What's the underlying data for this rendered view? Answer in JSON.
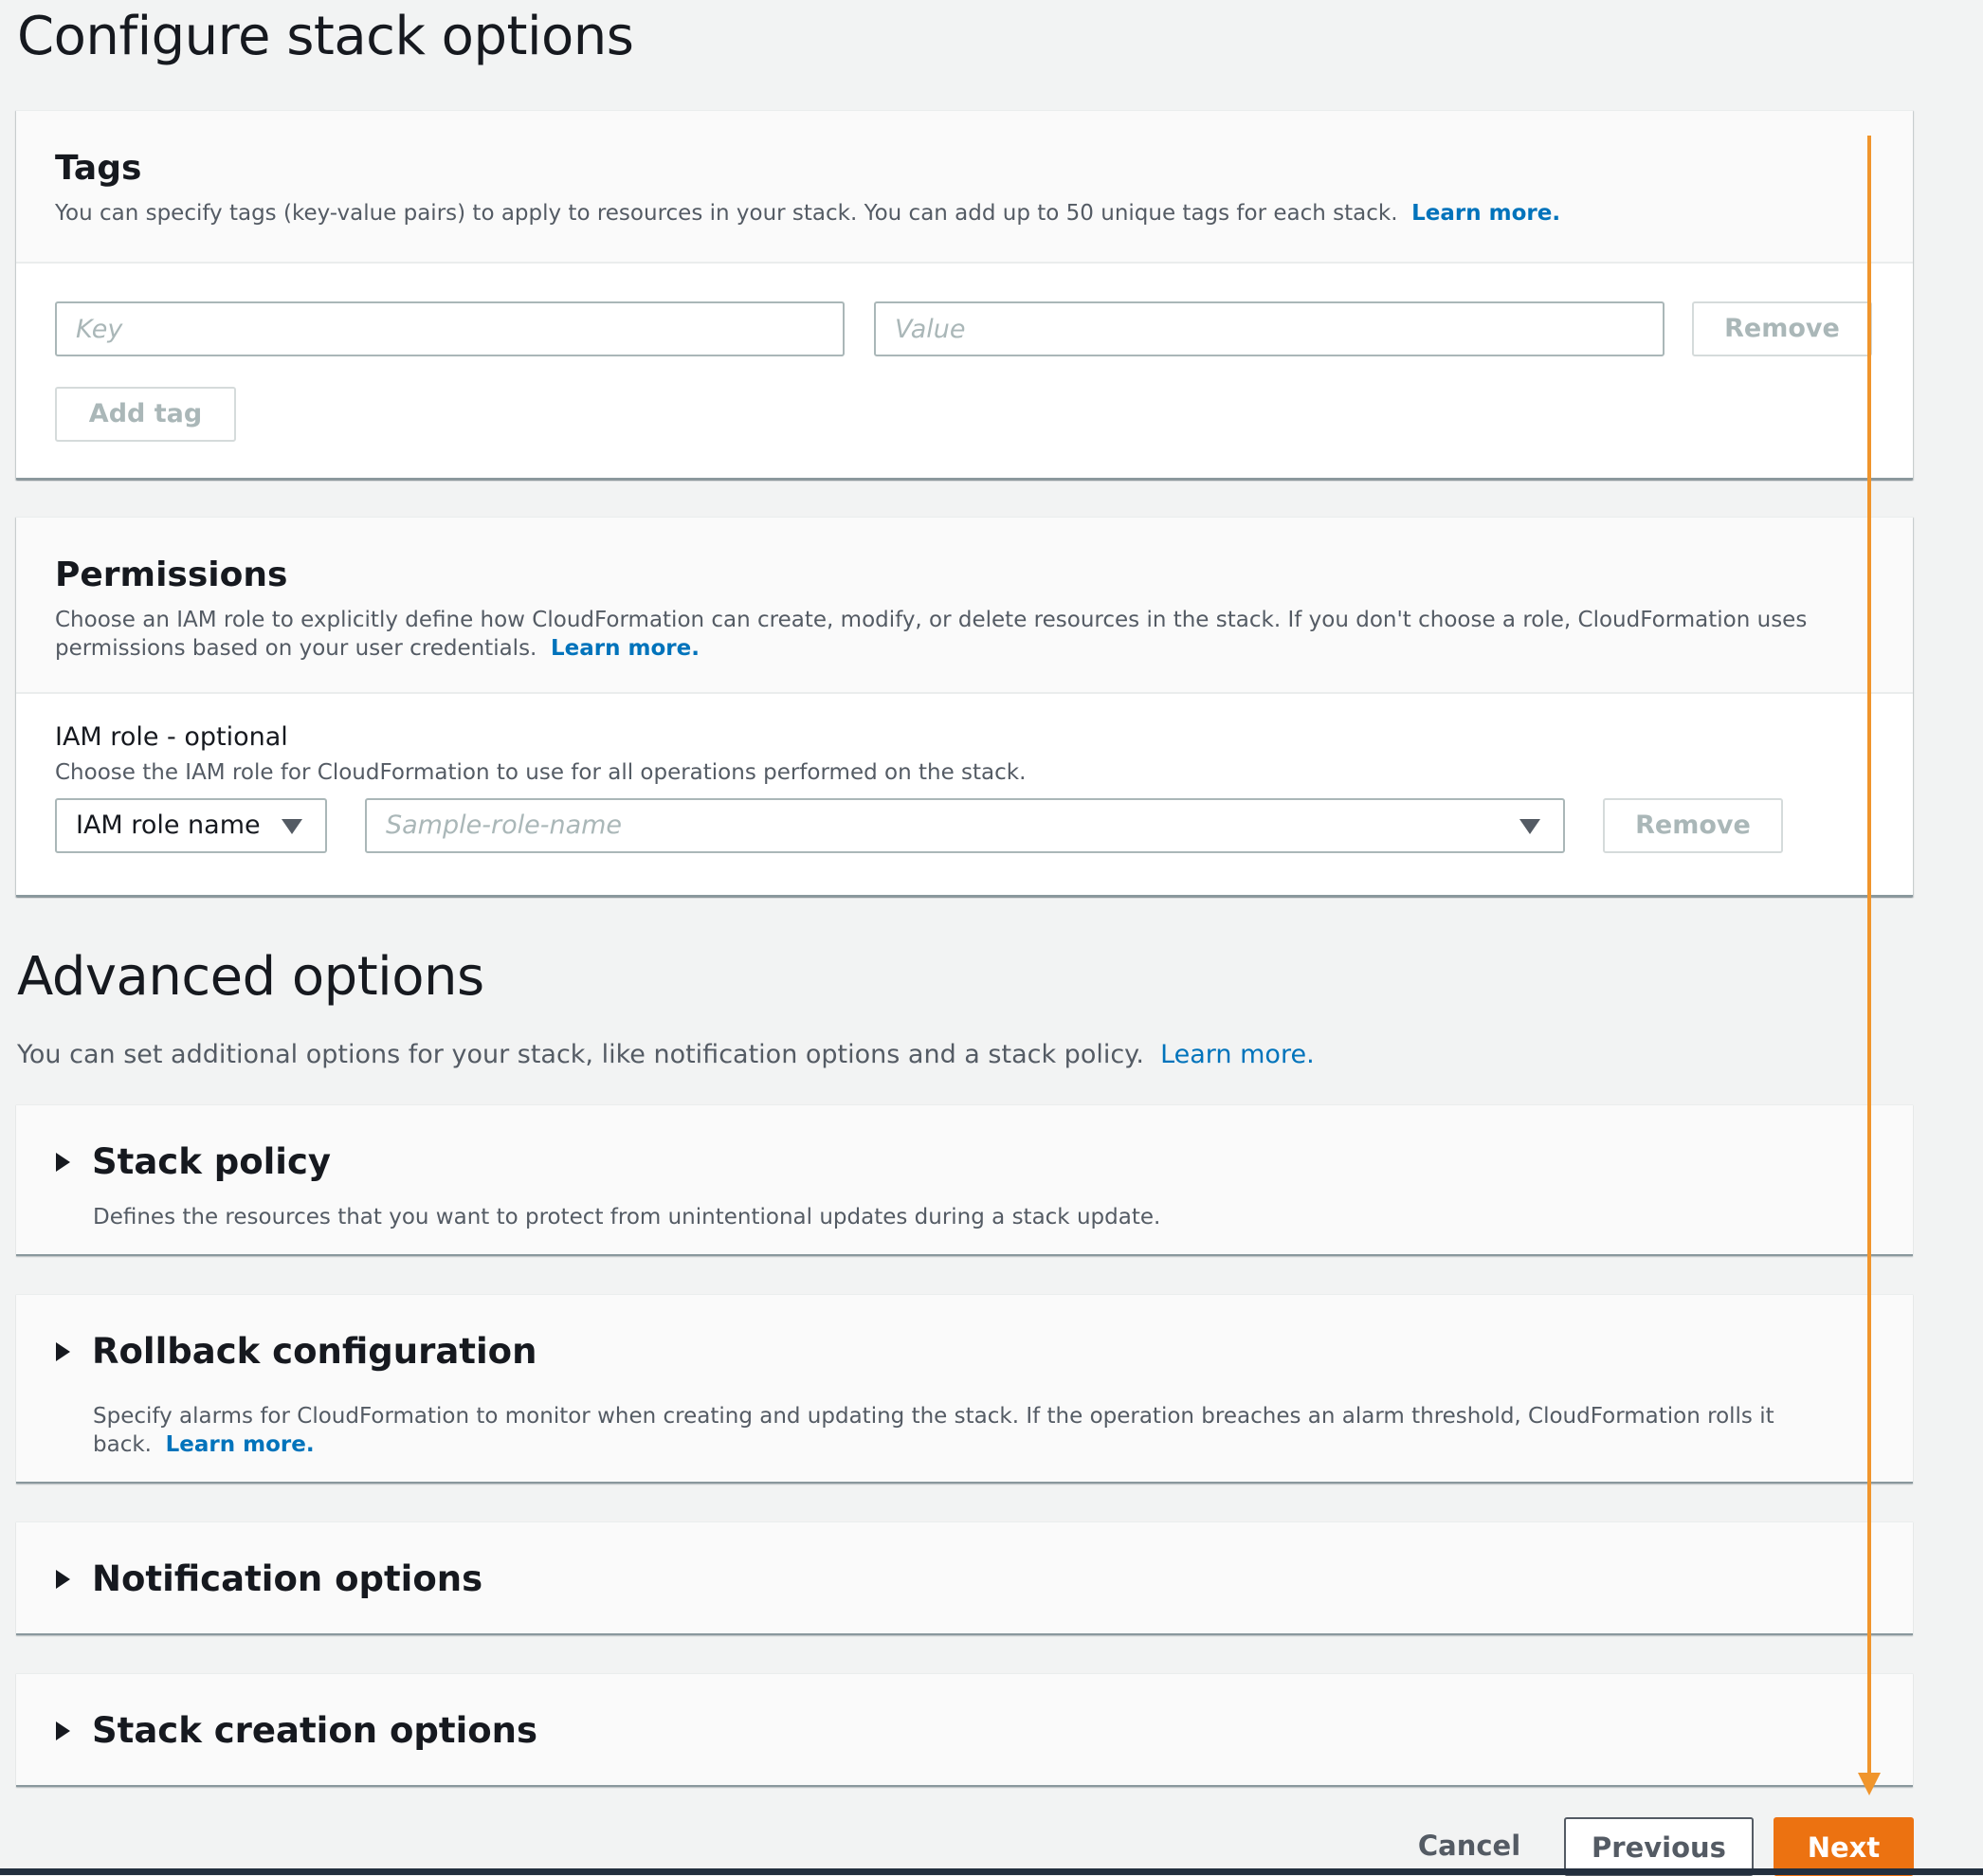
{
  "page": {
    "title": "Configure stack options"
  },
  "tags": {
    "title": "Tags",
    "description": "You can specify tags (key-value pairs) to apply to resources in your stack. You can add up to 50 unique tags for each stack.",
    "learn_more": "Learn more.",
    "key_placeholder": "Key",
    "key_value": "",
    "value_placeholder": "Value",
    "value_value": "",
    "remove_label": "Remove",
    "add_tag_label": "Add tag"
  },
  "permissions": {
    "title": "Permissions",
    "description": "Choose an IAM role to explicitly define how CloudFormation can create, modify, or delete resources in the stack. If you don't choose a role, CloudFormation uses permissions based on your user credentials.",
    "learn_more": "Learn more.",
    "iam_label": "IAM role - optional",
    "iam_help": "Choose the IAM role for CloudFormation to use for all operations performed on the stack.",
    "role_type_selected": "IAM role name",
    "role_name_placeholder": "Sample-role-name",
    "remove_label": "Remove"
  },
  "advanced": {
    "title": "Advanced options",
    "description": "You can set additional options for your stack, like notification options and a stack policy.",
    "learn_more": "Learn more.",
    "sections": [
      {
        "title": "Stack policy",
        "description": "Defines the resources that you want to protect from unintentional updates during a stack update.",
        "expanded": false
      },
      {
        "title": "Rollback configuration",
        "description": "Specify alarms for CloudFormation to monitor when creating and updating the stack. If the operation breaches an alarm threshold, CloudFormation rolls it back.",
        "learn_more": "Learn more.",
        "expanded": false
      },
      {
        "title": "Notification options",
        "expanded": false
      },
      {
        "title": "Stack creation options",
        "expanded": false
      }
    ]
  },
  "footer": {
    "cancel_label": "Cancel",
    "previous_label": "Previous",
    "next_label": "Next"
  },
  "annotation": {
    "type": "arrow-down",
    "color": "#f0952c",
    "points_to": "next-button"
  },
  "colors": {
    "primary": "#ec7211",
    "link": "#0073bb",
    "background": "#f2f3f3"
  }
}
